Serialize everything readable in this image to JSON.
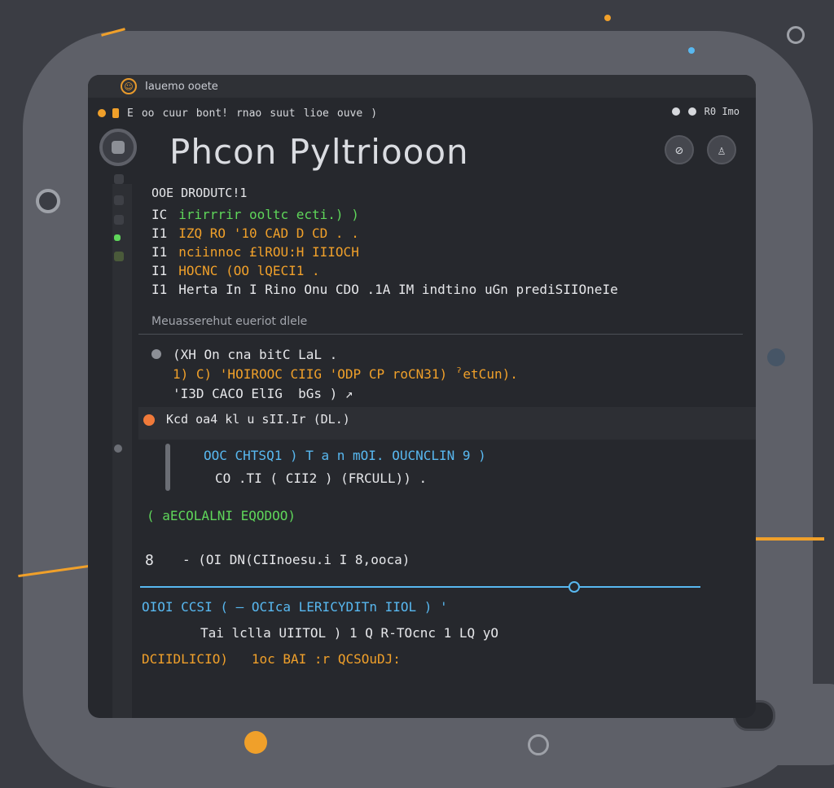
{
  "app": {
    "title": "Iauemo ooete",
    "icon": "smile-icon"
  },
  "menu": {
    "prefix": "E",
    "items": [
      "oo",
      "cuur",
      "bont!",
      "rnao",
      "suut",
      "lioe",
      "ouve",
      ")"
    ],
    "right_label": "R0 Imo"
  },
  "editor": {
    "title": "Phcon Pyltriooon",
    "header_line": "OOE DRODUTC!1",
    "lines": [
      {
        "prefix": "IC",
        "text": "irirrrir ooltc ecti.) )",
        "color": "#5fd65a"
      },
      {
        "prefix": "I1",
        "text": "IZQ RO '10 CAD D CD . .",
        "color": "#f0a02a"
      },
      {
        "prefix": "I1",
        "text": "nciinnoc £lROU:H IIIOCH",
        "color": "#f0a02a"
      },
      {
        "prefix": "I1",
        "text": "HOCNC (OO lQECI1 .",
        "color": "#f0a02a"
      },
      {
        "prefix": "I1",
        "text": "Herta In I Rino Onu CDO .1A IM indtino uGn prediSIIOneIe",
        "color": "#e6e7ea"
      }
    ]
  },
  "section": {
    "label": "Meuasserehut eueriot dlele",
    "lines": [
      {
        "text": "(XH On cna bitC LaL .",
        "color": "#e6e7ea"
      },
      {
        "text": "1) C) 'HOIROOC CIIG 'ODP CP roCN31) ˀetCun).",
        "color": "#f0a02a"
      },
      {
        "text": "'I3D CACO ElIG  bGs ) ↗",
        "color": "#e6e7ea"
      }
    ]
  },
  "result": {
    "label": "Kcd oa4 kl u sII.Ir (DL.)"
  },
  "block": {
    "line1": "OOC CHTSQ1 ) T a n mOI. OUCNCLIN 9 )",
    "line2": "CO .TI ( CII2 ) (FRCULL)) ."
  },
  "status_line": "( aECOLALNI EQODOO)",
  "prompt": {
    "marker": "8",
    "text": "- (OI DN(CIInoesu.i I 8,ooca)"
  },
  "console": {
    "lines": [
      {
        "text": "OIOI CCSI ( — OCIca LERICYDITn IIOL ) '",
        "color": "#58b8f0"
      },
      {
        "text": "Tai lclla UIITOL ) 1 Q R-TOcnc 1 LQ yO",
        "color": "#e6e7ea"
      },
      {
        "text": "DCIIDLICIO)   1oc BAI :r QCSOuDJ:",
        "color": "#f0a02a"
      }
    ]
  }
}
